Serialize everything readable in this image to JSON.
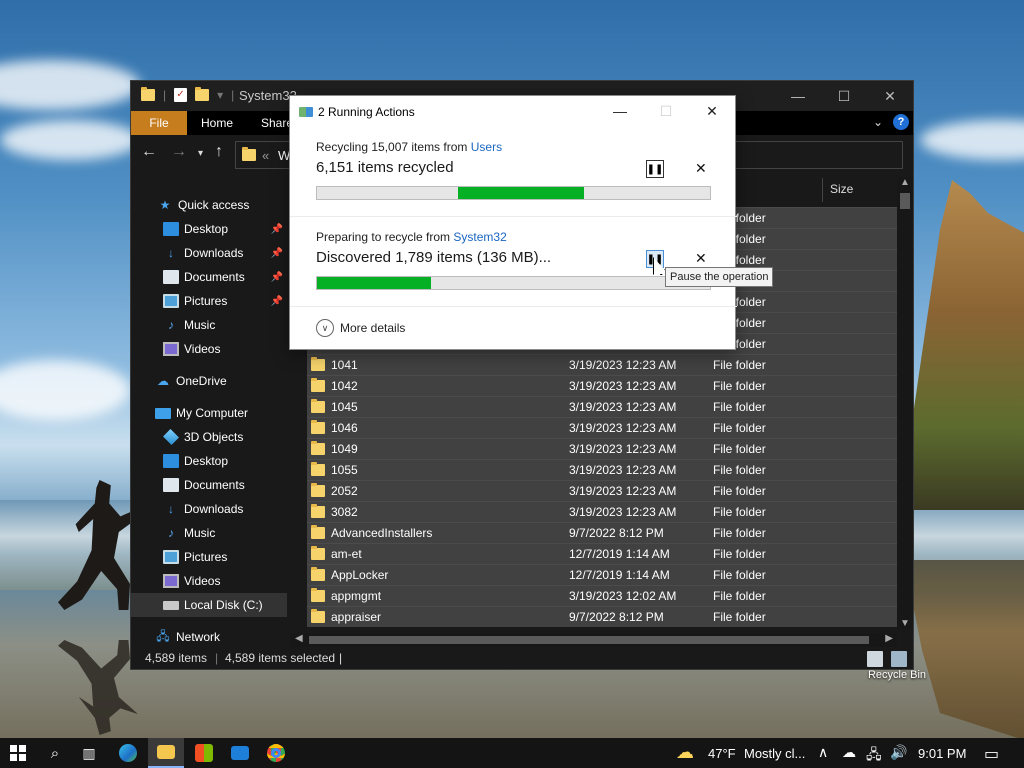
{
  "explorer": {
    "title": "System32",
    "ribbon_tabs": [
      "File",
      "Home",
      "Share"
    ],
    "address_prefix": "«",
    "address_text": "Wi",
    "column_size": "Size",
    "sidebar": [
      {
        "label": "Quick access",
        "icon": "star-icon",
        "pinned": false
      },
      {
        "label": "Desktop",
        "icon": "desktop-icon",
        "pinned": true
      },
      {
        "label": "Downloads",
        "icon": "download-icon",
        "pinned": true
      },
      {
        "label": "Documents",
        "icon": "documents-icon",
        "pinned": true
      },
      {
        "label": "Pictures",
        "icon": "pictures-icon",
        "pinned": true
      },
      {
        "label": "Music",
        "icon": "music-icon",
        "pinned": false
      },
      {
        "label": "Videos",
        "icon": "videos-icon",
        "pinned": false
      },
      {
        "label": "OneDrive",
        "icon": "onedrive-icon",
        "pinned": false
      },
      {
        "label": "My Computer",
        "icon": "computer-icon",
        "pinned": false
      },
      {
        "label": "3D Objects",
        "icon": "3d-objects-icon",
        "pinned": false
      },
      {
        "label": "Desktop",
        "icon": "desktop-icon",
        "pinned": false
      },
      {
        "label": "Documents",
        "icon": "documents-icon",
        "pinned": false
      },
      {
        "label": "Downloads",
        "icon": "download-icon",
        "pinned": false
      },
      {
        "label": "Music",
        "icon": "music-icon",
        "pinned": false
      },
      {
        "label": "Pictures",
        "icon": "pictures-icon",
        "pinned": false
      },
      {
        "label": "Videos",
        "icon": "videos-icon",
        "pinned": false
      },
      {
        "label": "Local Disk (C:)",
        "icon": "disk-icon",
        "pinned": false
      },
      {
        "label": "Network",
        "icon": "network-icon",
        "pinned": false
      }
    ],
    "files_partial_type": "File folder",
    "files": [
      {
        "name": "1041",
        "date": "3/19/2023 12:23 AM",
        "type": "File folder"
      },
      {
        "name": "1042",
        "date": "3/19/2023 12:23 AM",
        "type": "File folder"
      },
      {
        "name": "1045",
        "date": "3/19/2023 12:23 AM",
        "type": "File folder"
      },
      {
        "name": "1046",
        "date": "3/19/2023 12:23 AM",
        "type": "File folder"
      },
      {
        "name": "1049",
        "date": "3/19/2023 12:23 AM",
        "type": "File folder"
      },
      {
        "name": "1055",
        "date": "3/19/2023 12:23 AM",
        "type": "File folder"
      },
      {
        "name": "2052",
        "date": "3/19/2023 12:23 AM",
        "type": "File folder"
      },
      {
        "name": "3082",
        "date": "3/19/2023 12:23 AM",
        "type": "File folder"
      },
      {
        "name": "AdvancedInstallers",
        "date": "9/7/2022 8:12 PM",
        "type": "File folder"
      },
      {
        "name": "am-et",
        "date": "12/7/2019 1:14 AM",
        "type": "File folder"
      },
      {
        "name": "AppLocker",
        "date": "12/7/2019 1:14 AM",
        "type": "File folder"
      },
      {
        "name": "appmgmt",
        "date": "3/19/2023 12:02 AM",
        "type": "File folder"
      },
      {
        "name": "appraiser",
        "date": "9/7/2022 8:12 PM",
        "type": "File folder"
      }
    ],
    "status_items": "4,589 items",
    "status_selected": "4,589 items selected"
  },
  "dialog": {
    "title": "2 Running Actions",
    "action1": {
      "prefix": "Recycling 15,007 items from ",
      "link": "Users",
      "count": "6,151 items recycled",
      "progress_start": 0.36,
      "progress_end": 0.68
    },
    "action2": {
      "prefix": "Preparing to recycle from ",
      "link": "System32",
      "count": "Discovered 1,789 items (136 MB)...",
      "progress_start": 0.0,
      "progress_end": 0.29
    },
    "more_details": "More details",
    "tooltip": "Pause the operation"
  },
  "desktop": {
    "recycle_bin": "Recycle Bin"
  },
  "taskbar": {
    "weather_temp": "47°F",
    "weather_text": "Mostly cl...",
    "time": "9:01 PM"
  },
  "colors": {
    "accent_file_tab": "#c67d1d",
    "progress_green": "#06b025",
    "link_blue": "#1a66c2"
  }
}
